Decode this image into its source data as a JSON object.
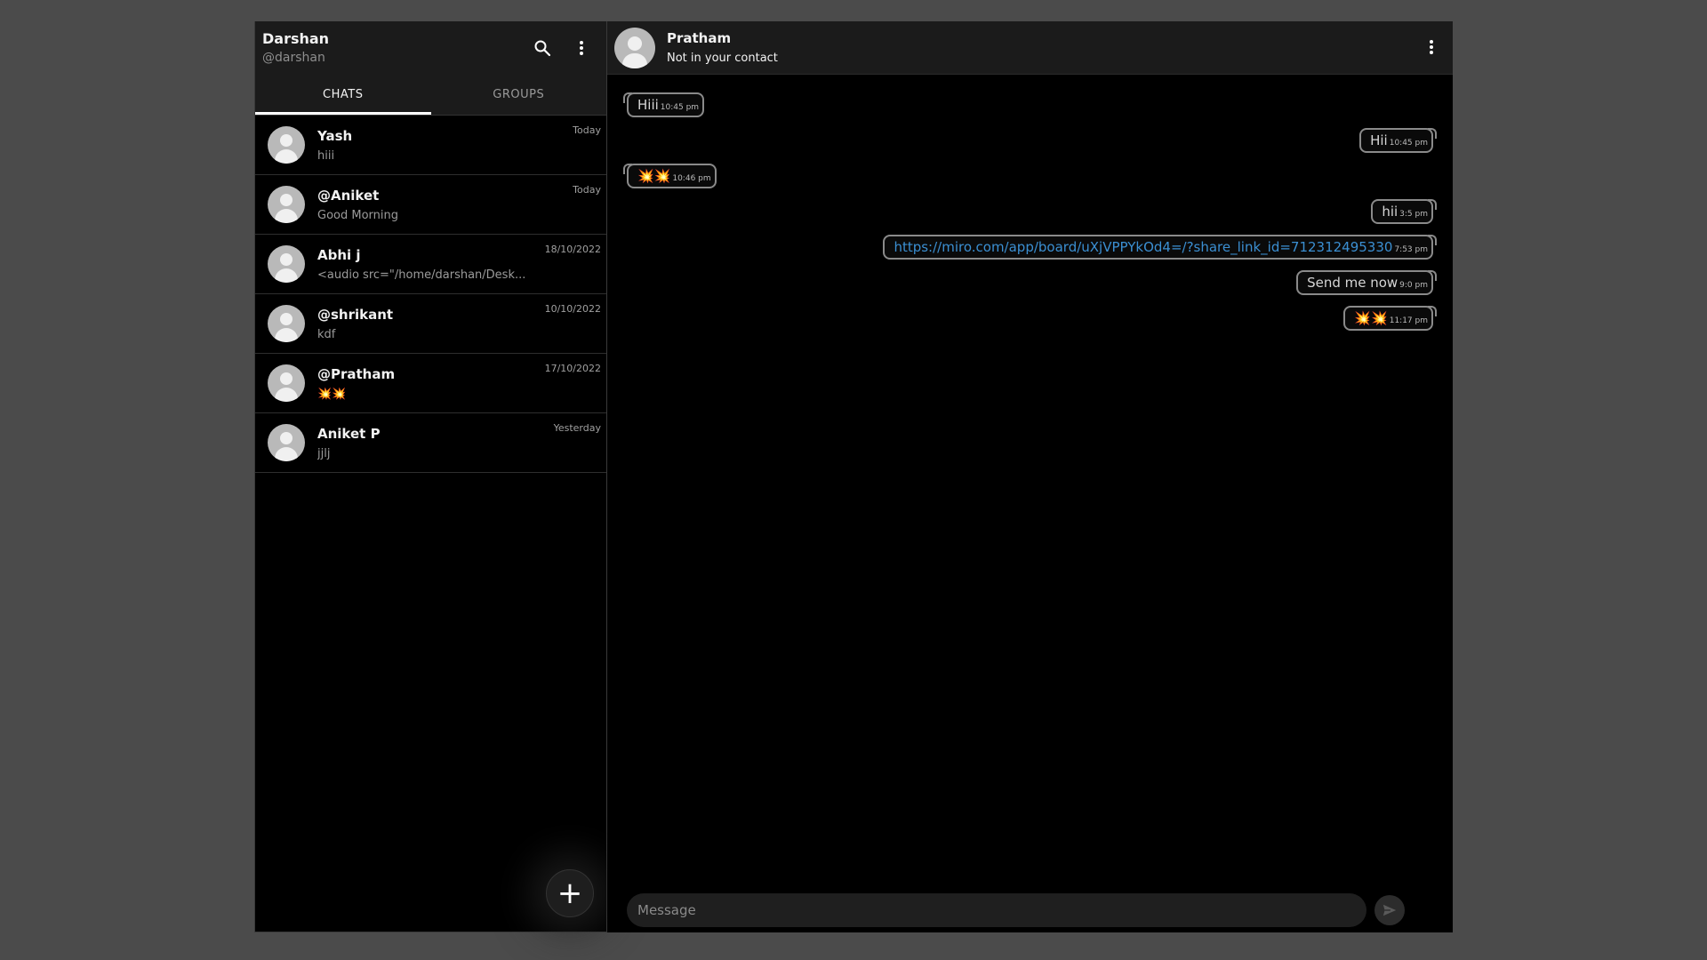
{
  "user": {
    "name": "Darshan",
    "handle": "@darshan"
  },
  "header_icons": {
    "search": "search-icon",
    "menu": "more-vert-icon"
  },
  "tabs": [
    {
      "label": "CHATS",
      "active": true
    },
    {
      "label": "GROUPS",
      "active": false
    }
  ],
  "chats": [
    {
      "name": "Yash",
      "preview": "hiii",
      "date": "Today"
    },
    {
      "name": "@Aniket",
      "preview": "Good Morning",
      "date": "Today"
    },
    {
      "name": "Abhi j",
      "preview": "<audio src=\"/home/darshan/Desk...",
      "date": "18/10/2022"
    },
    {
      "name": "@shrikant",
      "preview": "kdf",
      "date": "10/10/2022"
    },
    {
      "name": "@Pratham",
      "preview": "💥💥",
      "date": "17/10/2022"
    },
    {
      "name": "Aniket P",
      "preview": "jjlj",
      "date": "Yesterday"
    }
  ],
  "fab": {
    "label": "+"
  },
  "conversation": {
    "name": "Pratham",
    "subtitle": "Not in your contact",
    "messages": [
      {
        "direction": "in",
        "text": "Hiii",
        "time": "10:45 pm"
      },
      {
        "direction": "out",
        "text": "Hii",
        "time": "10:45 pm"
      },
      {
        "direction": "in",
        "text": "💥💥",
        "time": "10:46 pm"
      },
      {
        "direction": "out",
        "text": "hii",
        "time": "3:5 pm"
      },
      {
        "direction": "out",
        "text": "https://miro.com/app/board/uXjVPPYkOd4=/?share_link_id=712312495330",
        "time": "7:53 pm",
        "link": true
      },
      {
        "direction": "out",
        "text": "Send me now",
        "time": "9:0 pm"
      },
      {
        "direction": "out",
        "text": "💥💥",
        "time": "11:17 pm"
      }
    ]
  },
  "composer": {
    "placeholder": "Message",
    "send_icon": "send-icon"
  }
}
